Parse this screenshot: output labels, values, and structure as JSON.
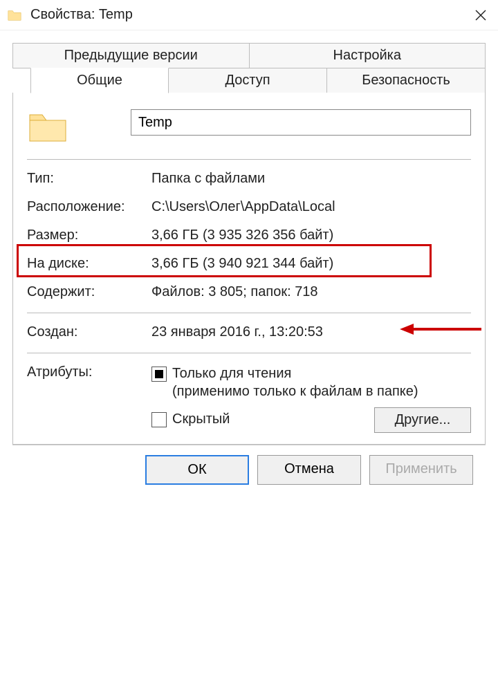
{
  "titlebar": {
    "title": "Свойства: Temp"
  },
  "tabs": {
    "prev_versions": "Предыдущие версии",
    "customize": "Настройка",
    "general": "Общие",
    "sharing": "Доступ",
    "security": "Безопасность"
  },
  "general": {
    "name_value": "Temp",
    "type_label": "Тип:",
    "type_value": "Папка с файлами",
    "location_label": "Расположение:",
    "location_value": "C:\\Users\\Олег\\AppData\\Local",
    "size_label": "Размер:",
    "size_value": "3,66 ГБ (3 935 326 356 байт)",
    "size_on_disk_label": "На диске:",
    "size_on_disk_value": "3,66 ГБ (3 940 921 344 байт)",
    "contains_label": "Содержит:",
    "contains_value": "Файлов: 3 805; папок: 718",
    "created_label": "Создан:",
    "created_value": "23 января 2016 г., 13:20:53",
    "attributes_label": "Атрибуты:",
    "readonly_text": "Только для чтения\n(применимо только к файлам в папке)",
    "hidden_text": "Скрытый",
    "other_button": "Другие..."
  },
  "footer": {
    "ok": "ОК",
    "cancel": "Отмена",
    "apply": "Применить"
  }
}
